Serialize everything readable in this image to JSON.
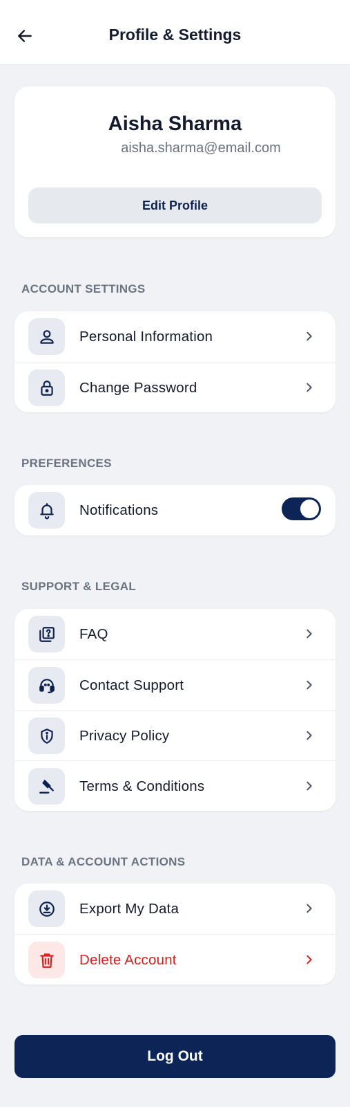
{
  "header": {
    "title": "Profile & Settings",
    "back_icon": "arrow-left-icon"
  },
  "profile": {
    "name": "Aisha Sharma",
    "email": "aisha.sharma@email.com",
    "edit_label": "Edit Profile"
  },
  "sections": {
    "account": {
      "label": "ACCOUNT SETTINGS",
      "items": [
        {
          "label": "Personal Information",
          "icon": "user-icon"
        },
        {
          "label": "Change Password",
          "icon": "lock-icon"
        }
      ]
    },
    "preferences": {
      "label": "PREFERENCES",
      "items": [
        {
          "label": "Notifications",
          "icon": "bell-icon",
          "toggle_on": true
        }
      ]
    },
    "support": {
      "label": "SUPPORT & LEGAL",
      "items": [
        {
          "label": "FAQ",
          "icon": "faq-icon"
        },
        {
          "label": "Contact Support",
          "icon": "headset-icon"
        },
        {
          "label": "Privacy Policy",
          "icon": "shield-icon"
        },
        {
          "label": "Terms & Conditions",
          "icon": "gavel-icon"
        }
      ]
    },
    "data": {
      "label": "DATA & ACCOUNT ACTIONS",
      "items": [
        {
          "label": "Export My Data",
          "icon": "download-icon"
        },
        {
          "label": "Delete Account",
          "icon": "trash-icon"
        }
      ]
    }
  },
  "logout_label": "Log Out",
  "colors": {
    "primary": "#0d2556",
    "danger": "#d62020",
    "background": "#f0f2f6",
    "muted_text": "#6b7280"
  }
}
